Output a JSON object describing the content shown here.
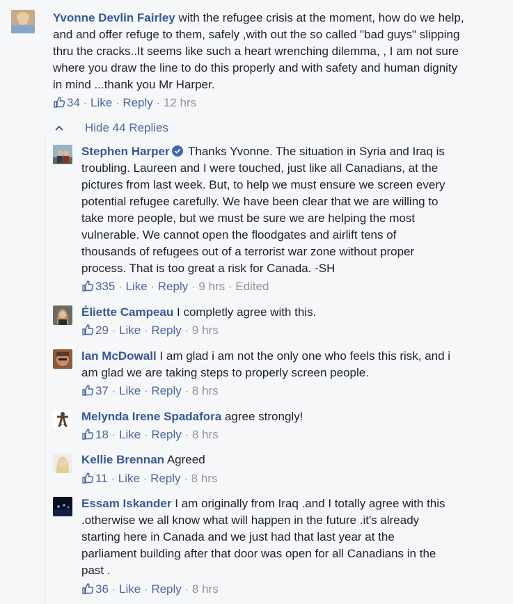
{
  "thread": {
    "top_comment": {
      "author": "Yvonne Devlin Fairley",
      "text": "with the refugee crisis at the moment, how do we help, and and offer refuge to them, safely ,with out the so called \"bad guys\" slipping thru the cracks..It seems like such a heart wrenching dilemma, , I am not sure where you draw the line to do this properly and with safety and human dignity in mind ...thank you Mr Harper.",
      "lines": [
        "with the refugee crisis at the moment, how do we help,",
        "and and offer refuge to them, safely ,with out the so called \"bad guys\" slipping",
        "thru the cracks..It seems like such a heart wrenching dilemma, , I am not sure",
        "where you draw the line to do this properly and with safety and human dignity",
        "in mind ...thank you Mr Harper."
      ],
      "likes": "34",
      "like_label": "Like",
      "reply_label": "Reply",
      "time": "12 hrs"
    },
    "hide_replies_label": "Hide 44 Replies",
    "replies": [
      {
        "author": "Stephen Harper",
        "verified": true,
        "lines": [
          "Thanks Yvonne. The situation in Syria and Iraq is",
          "troubling. Laureen and I were touched, just like all Canadians, at the",
          "pictures from last week. But, to help we must ensure we screen every",
          "potential refugee carefully. We have been clear that we are willing to",
          "take more people, but we must be sure we are helping the most",
          "vulnerable. We cannot open the floodgates and airlift tens of",
          "thousands of refugees out of a terrorist war zone without proper",
          "process. That is too great a risk for Canada. -SH"
        ],
        "likes": "335",
        "like_label": "Like",
        "reply_label": "Reply",
        "time": "9 hrs",
        "edited": "Edited"
      },
      {
        "author": "Éliette Campeau",
        "lines": [
          "I completly agree with this."
        ],
        "likes": "29",
        "like_label": "Like",
        "reply_label": "Reply",
        "time": "9 hrs"
      },
      {
        "author": "Ian McDowall",
        "lines": [
          "I am glad i am not the only one who feels this risk, and i",
          "am glad we are taking steps to properly screen people."
        ],
        "likes": "37",
        "like_label": "Like",
        "reply_label": "Reply",
        "time": "8 hrs"
      },
      {
        "author": "Melynda Irene Spadafora",
        "lines": [
          "agree strongly!"
        ],
        "likes": "18",
        "like_label": "Like",
        "reply_label": "Reply",
        "time": "8 hrs"
      },
      {
        "author": "Kellie Brennan",
        "lines": [
          "Agreed"
        ],
        "likes": "11",
        "like_label": "Like",
        "reply_label": "Reply",
        "time": "8 hrs"
      },
      {
        "author": "Essam Iskander",
        "lines": [
          "I am originally from Iraq .and I totally agree with this",
          ".otherwise we all know what will happen in the future .it's already",
          "starting here in Canada and we just had that last year at the",
          "parliament building after that door was open for all Canadians in the",
          "past ."
        ],
        "likes": "36",
        "like_label": "Like",
        "reply_label": "Reply",
        "time": "8 hrs"
      }
    ]
  },
  "icons": {
    "like": "thumbs-up-icon",
    "collapse": "chevron-up-icon",
    "verified": "verified-badge-icon"
  },
  "colors": {
    "link": "#365899",
    "action": "#4b67a1",
    "meta": "#90949c",
    "background": "#f6f7f9",
    "verified": "#4267b2"
  }
}
